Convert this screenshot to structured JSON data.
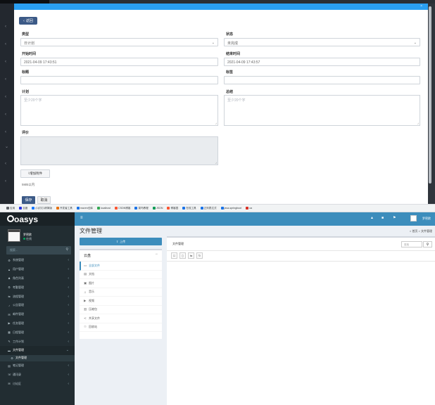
{
  "form": {
    "back_label": "返回",
    "type_label": "类型",
    "type_value": "日计划",
    "status_label": "状态",
    "status_value": "未完成",
    "start_label": "开始时间",
    "start_value": "2021-04-09 17:43:51",
    "end_label": "结束时间",
    "end_value": "2021-04-09 17:43:57",
    "title_label": "标题",
    "tag_label": "标签",
    "plan_label": "计划",
    "plan_placeholder": "至少20个字",
    "summary_label": "总结",
    "summary_placeholder": "至少20个字",
    "comment_label": "评价",
    "upload_label": "增加附件",
    "max_note": "5MB以内",
    "save_label": "保存",
    "cancel_label": "取消"
  },
  "bookmarks": [
    {
      "label": "应用",
      "color": "#5f6368"
    },
    {
      "label": "百度",
      "color": "#2932e1"
    },
    {
      "label": "(1)钉钉-精简版",
      "color": "#1677ff"
    },
    {
      "label": "开发者工具",
      "color": "#e8710a"
    },
    {
      "label": "maven仓库",
      "color": "#1a73e8"
    },
    {
      "label": "localhost",
      "color": "#34a853"
    },
    {
      "label": "CSDN博客",
      "color": "#fc5531"
    },
    {
      "label": "菜鸟教程",
      "color": "#1a73e8"
    },
    {
      "label": "JSON",
      "color": "#0f9d58"
    },
    {
      "label": "博客园",
      "color": "#fc5531"
    },
    {
      "label": "在线工具",
      "color": "#1a73e8"
    },
    {
      "label": "正则表达式",
      "color": "#1a73e8"
    },
    {
      "label": "java-springboot",
      "color": "#1a73e8"
    },
    {
      "label": "oa",
      "color": "#d93025"
    }
  ],
  "app": {
    "logo": "oasys",
    "user_name": "罗密欧",
    "user_status": "在线",
    "search_placeholder": "搜索...",
    "menu": [
      {
        "label": "系统管理",
        "icon": "⚙"
      },
      {
        "label": "用户管理",
        "icon": "▲"
      },
      {
        "label": "角色列表",
        "icon": "♟"
      },
      {
        "label": "考勤管理",
        "icon": "⏲"
      },
      {
        "label": "流程管理",
        "icon": "⇆"
      },
      {
        "label": "公告管理",
        "icon": "♪"
      },
      {
        "label": "邮件管理",
        "icon": "✉"
      },
      {
        "label": "任务管理",
        "icon": "▶"
      },
      {
        "label": "日程管理",
        "icon": "▦"
      },
      {
        "label": "工作计划",
        "icon": "✎"
      },
      {
        "label": "文件管理",
        "icon": "▬"
      }
    ],
    "submenu_label": "文件管理",
    "menu_after": [
      {
        "label": "笔记管理",
        "icon": "▤"
      },
      {
        "label": "通讯录",
        "icon": "☏"
      },
      {
        "label": "讨论区",
        "icon": "✉"
      }
    ],
    "page_title": "文件管理",
    "breadcrumb": "首页 > 文件管理",
    "upload_button": "上传",
    "cloud_title": "云盘",
    "cloud_items": [
      {
        "label": "全部文件",
        "icon": "▭"
      },
      {
        "label": "文档",
        "icon": "▤"
      },
      {
        "label": "图片",
        "icon": "▣"
      },
      {
        "label": "音乐",
        "icon": "♫"
      },
      {
        "label": "视频",
        "icon": "▶"
      },
      {
        "label": "压缩包",
        "icon": "▥"
      },
      {
        "label": "共享文件",
        "icon": "≺"
      },
      {
        "label": "回收站",
        "icon": "♲"
      }
    ],
    "file_panel_title": "文件管理",
    "file_search_placeholder": "查找",
    "user_badge": "罗密欧"
  },
  "colors": {
    "accent": "#3c8dbc",
    "sidebar": "#222d32",
    "top_bar": "#2a9ff2",
    "button_dark": "#3c5a87"
  }
}
